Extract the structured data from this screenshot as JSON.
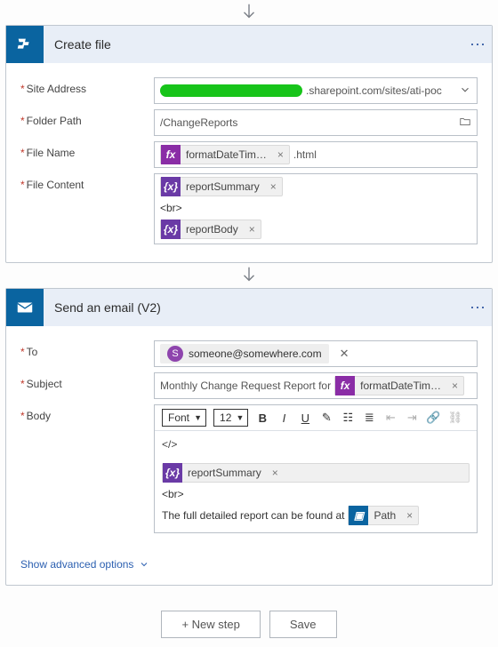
{
  "card1": {
    "title": "Create file",
    "fields": {
      "siteAddress": {
        "label": "Site Address",
        "tailText": ".sharepoint.com/sites/ati-poc"
      },
      "folderPath": {
        "label": "Folder Path",
        "value": "/ChangeReports"
      },
      "fileName": {
        "label": "File Name",
        "tokenFx": "formatDateTim…",
        "after": ".html"
      },
      "fileContent": {
        "label": "File Content",
        "tokenVar1": "reportSummary",
        "literal": "<br>",
        "tokenVar2": "reportBody"
      }
    }
  },
  "card2": {
    "title": "Send an email (V2)",
    "fields": {
      "to": {
        "label": "To",
        "chipInitial": "S",
        "chipText": "someone@somewhere.com"
      },
      "subject": {
        "label": "Subject",
        "leadText": "Monthly Change Request Report for",
        "tokenFx": "formatDateTim…"
      },
      "body": {
        "label": "Body",
        "toolbar": {
          "font": "Font",
          "size": "12"
        },
        "tokenVar": "reportSummary",
        "literal": "<br>",
        "line": "The full detailed report can be found at",
        "tokenSp": "Path"
      }
    },
    "advanced": "Show advanced options"
  },
  "footer": {
    "newStep": "+ New step",
    "save": "Save"
  }
}
